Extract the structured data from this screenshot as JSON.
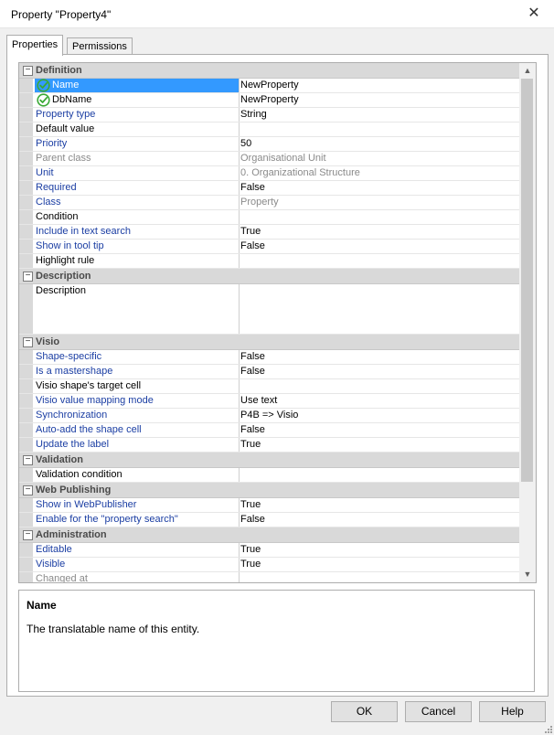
{
  "window": {
    "title": "Property \"Property4\"",
    "close_glyph": "✕"
  },
  "tabs": [
    {
      "label": "Properties",
      "active": true
    },
    {
      "label": "Permissions",
      "active": false
    }
  ],
  "sections": [
    {
      "title": "Definition",
      "expander": "−",
      "rows": [
        {
          "name": "Name",
          "value": "NewProperty",
          "name_color": "white",
          "value_color": "black",
          "icon": "green-check-icon",
          "selected": true
        },
        {
          "name": "DbName",
          "value": "NewProperty",
          "name_color": "black",
          "value_color": "black",
          "icon": "green-check-icon"
        },
        {
          "name": "Property type",
          "value": "String",
          "name_color": "blue",
          "value_color": "black"
        },
        {
          "name": "Default value",
          "value": "",
          "name_color": "black",
          "value_color": "black"
        },
        {
          "name": "Priority",
          "value": "50",
          "name_color": "blue",
          "value_color": "black"
        },
        {
          "name": "Parent class",
          "value": "Organisational Unit",
          "name_color": "gray",
          "value_color": "gray"
        },
        {
          "name": "Unit",
          "value": "0. Organizational Structure",
          "name_color": "blue",
          "value_color": "gray"
        },
        {
          "name": "Required",
          "value": "False",
          "name_color": "blue",
          "value_color": "black"
        },
        {
          "name": "Class",
          "value": "Property",
          "name_color": "blue",
          "value_color": "gray"
        },
        {
          "name": "Condition",
          "value": "",
          "name_color": "black",
          "value_color": "black"
        },
        {
          "name": "Include in text search",
          "value": "True",
          "name_color": "blue",
          "value_color": "black"
        },
        {
          "name": "Show in tool tip",
          "value": "False",
          "name_color": "blue",
          "value_color": "black"
        },
        {
          "name": "Highlight rule",
          "value": "",
          "name_color": "black",
          "value_color": "black"
        }
      ]
    },
    {
      "title": "Description",
      "expander": "−",
      "rows": [
        {
          "name": "Description",
          "value": "",
          "name_color": "black",
          "value_color": "black",
          "tall": true
        }
      ]
    },
    {
      "title": "Visio",
      "expander": "−",
      "rows": [
        {
          "name": "Shape-specific",
          "value": "False",
          "name_color": "blue",
          "value_color": "black"
        },
        {
          "name": "Is a mastershape",
          "value": "False",
          "name_color": "blue",
          "value_color": "black"
        },
        {
          "name": "Visio shape's target cell",
          "value": "",
          "name_color": "black",
          "value_color": "black"
        },
        {
          "name": "Visio value mapping mode",
          "value": "Use text",
          "name_color": "blue",
          "value_color": "black"
        },
        {
          "name": "Synchronization",
          "value": "P4B => Visio",
          "name_color": "blue",
          "value_color": "black"
        },
        {
          "name": "Auto-add the shape cell",
          "value": "False",
          "name_color": "blue",
          "value_color": "black"
        },
        {
          "name": "Update the label",
          "value": "True",
          "name_color": "blue",
          "value_color": "black"
        }
      ]
    },
    {
      "title": "Validation",
      "expander": "−",
      "rows": [
        {
          "name": "Validation condition",
          "value": "",
          "name_color": "black",
          "value_color": "black"
        }
      ]
    },
    {
      "title": "Web Publishing",
      "expander": "−",
      "rows": [
        {
          "name": "Show in WebPublisher",
          "value": "True",
          "name_color": "blue",
          "value_color": "black"
        },
        {
          "name": "Enable for the \"property search\"",
          "value": "False",
          "name_color": "blue",
          "value_color": "black"
        }
      ]
    },
    {
      "title": "Administration",
      "expander": "−",
      "rows": [
        {
          "name": "Editable",
          "value": "True",
          "name_color": "blue",
          "value_color": "black"
        },
        {
          "name": "Visible",
          "value": "True",
          "name_color": "blue",
          "value_color": "black"
        },
        {
          "name": "Changed at",
          "value": "",
          "name_color": "gray",
          "value_color": "black"
        }
      ]
    }
  ],
  "scrollbar": {
    "up_glyph": "▲",
    "down_glyph": "▼"
  },
  "description_panel": {
    "title": "Name",
    "text": "The translatable name of this entity."
  },
  "buttons": {
    "ok": "OK",
    "cancel": "Cancel",
    "help": "Help"
  },
  "colors": {
    "blue_label": "#1b3ea3",
    "gray_label": "#8a8a8a",
    "selection": "#3399ff",
    "section_bg": "#d9d9d9",
    "check_green": "#3aa935"
  }
}
